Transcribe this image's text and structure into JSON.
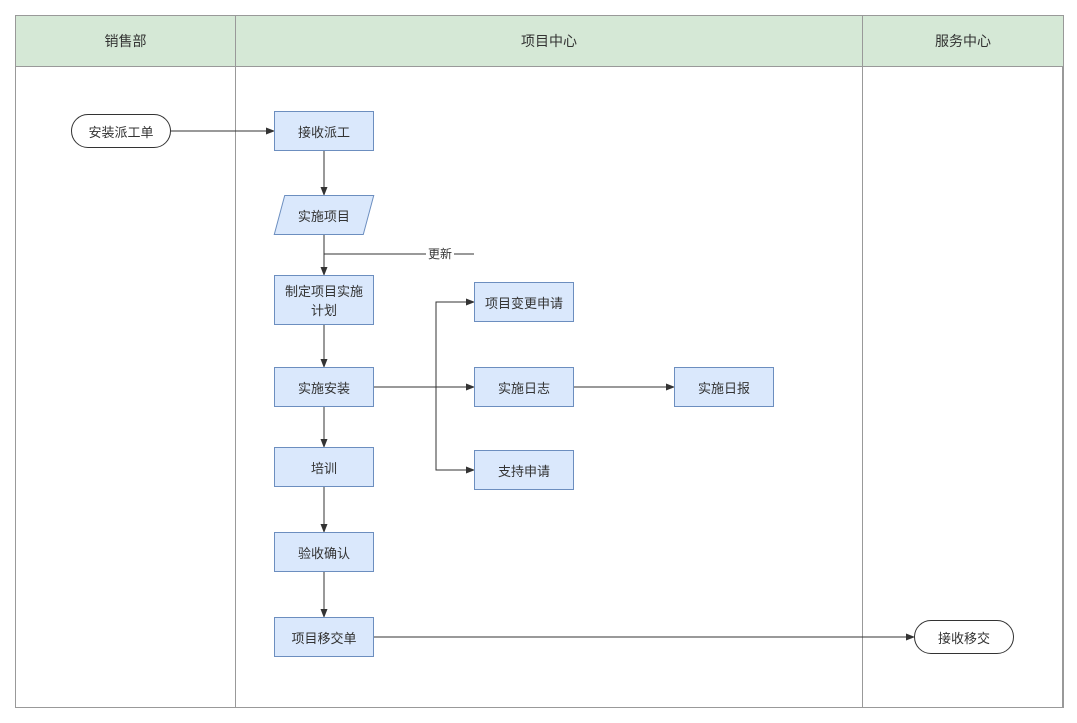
{
  "lanes": {
    "sales": "销售部",
    "project": "项目中心",
    "service": "服务中心"
  },
  "nodes": {
    "dispatch_order": "安装派工单",
    "receive_dispatch": "接收派工",
    "impl_project": "实施项目",
    "make_plan": "制定项目实施计划",
    "impl_install": "实施安装",
    "training": "培训",
    "accept_confirm": "验收确认",
    "handover_order": "项目移交单",
    "change_request": "项目变更申请",
    "impl_log": "实施日志",
    "support_request": "支持申请",
    "daily_report": "实施日报",
    "receive_handover": "接收移交"
  },
  "edges": {
    "update": "更新"
  }
}
